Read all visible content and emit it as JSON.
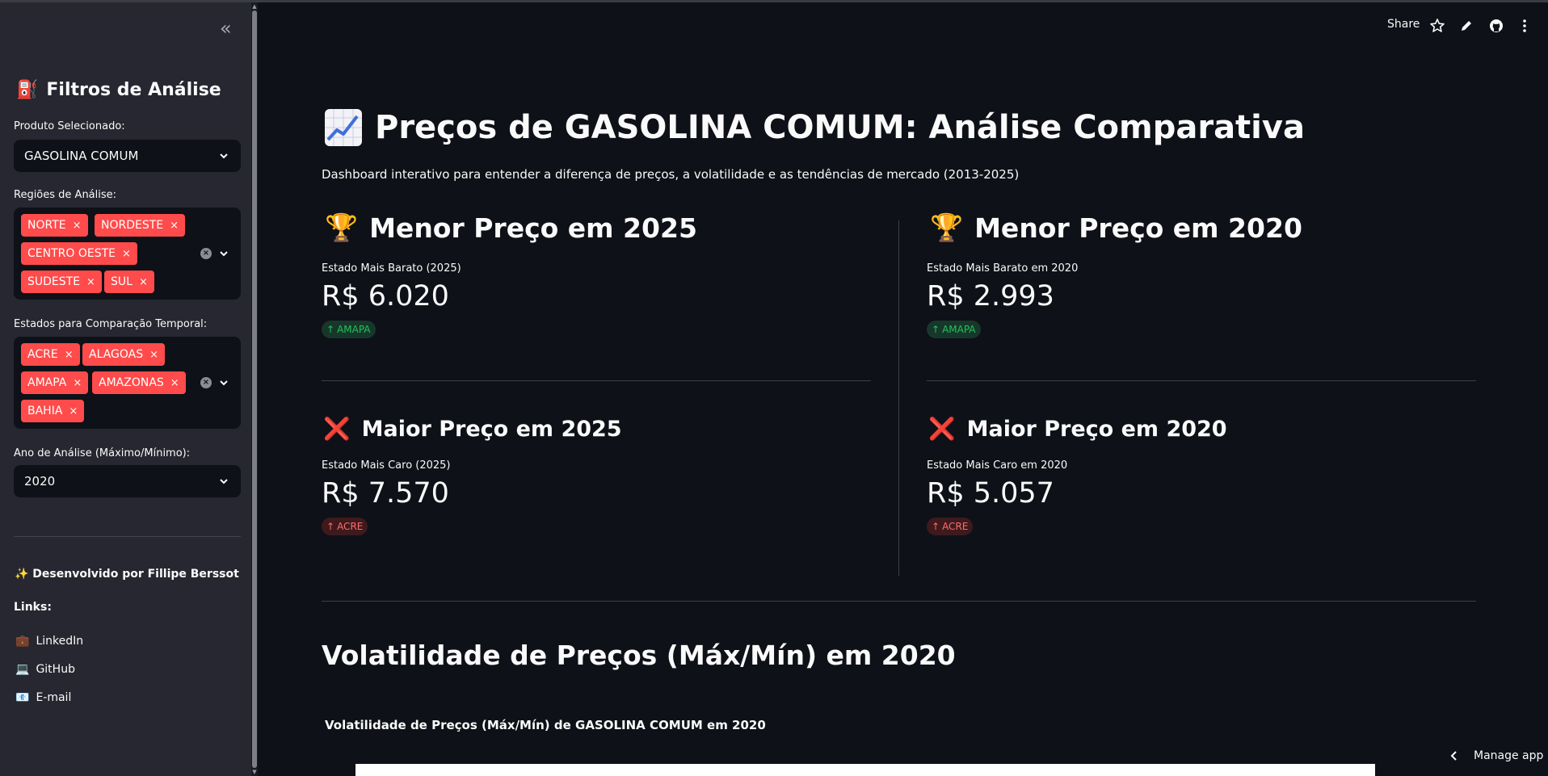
{
  "sidebar": {
    "title_emoji": "⛽",
    "title": "Filtros de Análise",
    "product_label": "Produto Selecionado:",
    "product_value": "GASOLINA COMUM",
    "regions_label": "Regiões de Análise:",
    "regions": [
      "NORTE",
      "NORDESTE",
      "CENTRO OESTE",
      "SUDESTE",
      "SUL"
    ],
    "states_label": "Estados para Comparação Temporal:",
    "states": [
      "ACRE",
      "ALAGOAS",
      "AMAPA",
      "AMAZONAS",
      "BAHIA"
    ],
    "year_label": "Ano de Análise (Máximo/Mínimo):",
    "year_value": "2020",
    "developer": "✨ Desenvolvido por Fillipe Berssot",
    "links_label": "Links:",
    "links": [
      {
        "icon": "💼",
        "label": "LinkedIn"
      },
      {
        "icon": "💻",
        "label": "GitHub"
      },
      {
        "icon": "📧",
        "label": "E-mail"
      }
    ],
    "tag_remove_glyph": "×"
  },
  "header": {
    "share_label": "Share",
    "icons": [
      "star-icon",
      "pencil-icon",
      "github-icon",
      "more-vertical-icon"
    ]
  },
  "main": {
    "title": "Preços de GASOLINA COMUM: Análise Comparativa",
    "subtitle": "Dashboard interativo para entender a diferença de preços, a volatilidade e as tendências de mercado (2013-2025)",
    "cards": {
      "min_2025": {
        "emoji": "🏆",
        "title": "Menor Preço em 2025",
        "label": "Estado Mais Barato (2025)",
        "value": "R$ 6.020",
        "delta": "AMAPA"
      },
      "min_2020": {
        "emoji": "🏆",
        "title": "Menor Preço em 2020",
        "label": "Estado Mais Barato em 2020",
        "value": "R$ 2.993",
        "delta": "AMAPA"
      },
      "max_2025": {
        "emoji": "❌",
        "title": "Maior Preço em 2025",
        "label": "Estado Mais Caro (2025)",
        "value": "R$ 7.570",
        "delta": "ACRE"
      },
      "max_2020": {
        "emoji": "❌",
        "title": "Maior Preço em 2020",
        "label": "Estado Mais Caro em 2020",
        "value": "R$ 5.057",
        "delta": "ACRE"
      }
    },
    "delta_arrow": "↑",
    "volatility_heading": "Volatilidade de Preços (Máx/Mín) em 2020",
    "chart_title": "Volatilidade de Preços (Máx/Mín) de GASOLINA COMUM em 2020"
  },
  "footer": {
    "manage_label": "Manage app"
  },
  "colors": {
    "background": "#0e1117",
    "sidebar": "#262730",
    "accent": "#ff4b4b",
    "delta_green": "#21c35d",
    "delta_red": "#ff6b6b"
  }
}
